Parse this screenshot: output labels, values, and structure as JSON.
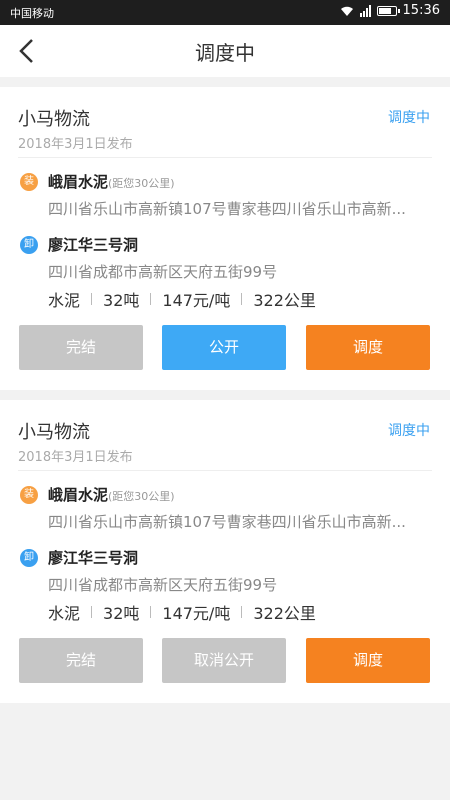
{
  "status_bar": {
    "carrier": "中国移动",
    "time": "15:36"
  },
  "nav": {
    "title": "调度中"
  },
  "orders": [
    {
      "company": "小马物流",
      "status": "调度中",
      "date": "2018年3月1日发布",
      "load": {
        "badge": "装",
        "name": "峨眉水泥",
        "distance": "(距您30公里)",
        "address": "四川省乐山市高新镇107号曹家巷四川省乐山市高新..."
      },
      "unload": {
        "badge": "卸",
        "name": "廖江华三号洞",
        "address": "四川省成都市高新区天府五街99号"
      },
      "specs": [
        "水泥",
        "32吨",
        "147元/吨",
        "322公里"
      ],
      "buttons": [
        "完结",
        "公开",
        "调度"
      ]
    },
    {
      "company": "小马物流",
      "status": "调度中",
      "date": "2018年3月1日发布",
      "load": {
        "badge": "装",
        "name": "峨眉水泥",
        "distance": "(距您30公里)",
        "address": "四川省乐山市高新镇107号曹家巷四川省乐山市高新..."
      },
      "unload": {
        "badge": "卸",
        "name": "廖江华三号洞",
        "address": "四川省成都市高新区天府五街99号"
      },
      "specs": [
        "水泥",
        "32吨",
        "147元/吨",
        "322公里"
      ],
      "buttons": [
        "完结",
        "取消公开",
        "调度"
      ]
    }
  ],
  "colors": {
    "accent_blue": "#3ea9f5",
    "accent_orange": "#f58220",
    "disabled_gray": "#c6c6c6",
    "load_badge": "#f7a043"
  }
}
